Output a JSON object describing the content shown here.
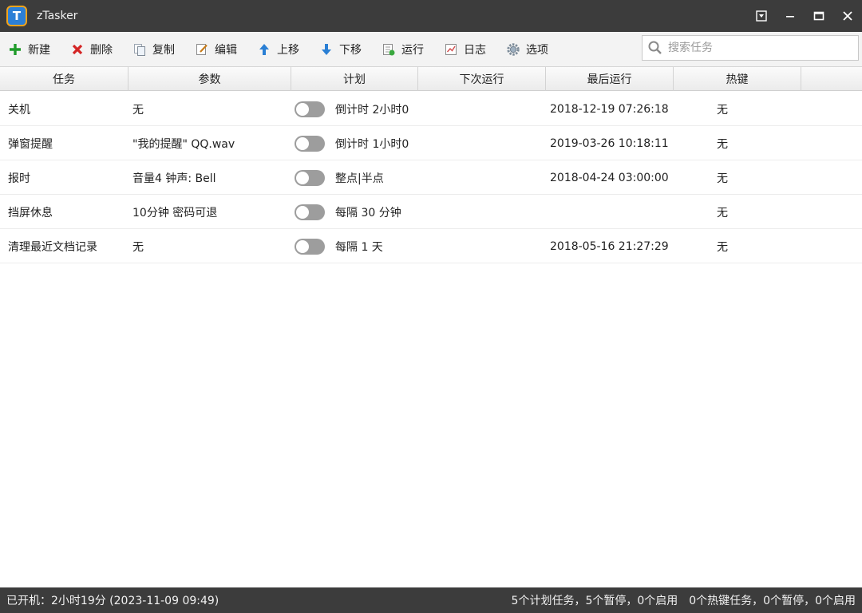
{
  "window": {
    "logo_letter": "T",
    "title": "zTasker",
    "controls": {
      "menu": "▾",
      "minimize": "—",
      "maximize": "☐",
      "close": "✕"
    }
  },
  "toolbar": {
    "buttons": [
      {
        "label": "新建",
        "icon": "plus-icon"
      },
      {
        "label": "删除",
        "icon": "x-icon"
      },
      {
        "label": "复制",
        "icon": "copy-icon"
      },
      {
        "label": "编辑",
        "icon": "edit-icon"
      },
      {
        "label": "上移",
        "icon": "arrow-up-icon"
      },
      {
        "label": "下移",
        "icon": "arrow-down-icon"
      },
      {
        "label": "运行",
        "icon": "run-icon"
      },
      {
        "label": "日志",
        "icon": "log-icon"
      },
      {
        "label": "选项",
        "icon": "gear-icon"
      }
    ],
    "search_placeholder": "搜索任务"
  },
  "table": {
    "headers": [
      "任务",
      "参数",
      "计划",
      "下次运行",
      "最后运行",
      "热键"
    ],
    "rows": [
      {
        "task": "关机",
        "param": "无",
        "enabled": false,
        "plan": "倒计时 2小时0",
        "next": "",
        "last": "2018-12-19 07:26:18",
        "hotkey": "无"
      },
      {
        "task": "弹窗提醒",
        "param": "\"我的提醒\" QQ.wav",
        "enabled": false,
        "plan": "倒计时 1小时0",
        "next": "",
        "last": "2019-03-26 10:18:11",
        "hotkey": "无"
      },
      {
        "task": "报时",
        "param": "音量4 钟声: Bell",
        "enabled": false,
        "plan": "整点|半点",
        "next": "",
        "last": "2018-04-24 03:00:00",
        "hotkey": "无"
      },
      {
        "task": "挡屏休息",
        "param": "10分钟 密码可退",
        "enabled": false,
        "plan": "每隔 30 分钟",
        "next": "",
        "last": "",
        "hotkey": "无"
      },
      {
        "task": "清理最近文档记录",
        "param": "无",
        "enabled": false,
        "plan": "每隔 1 天",
        "next": "",
        "last": "2018-05-16 21:27:29",
        "hotkey": "无"
      }
    ]
  },
  "status": {
    "uptime": "已开机：2小时19分 (2023-11-09 09:49)",
    "scheduled": "5个计划任务，5个暂停，0个启用",
    "hotkeys": "0个热键任务，0个暂停，0个启用"
  },
  "colors": {
    "titlebar": "#3c3c3c",
    "toggle_off": "#9d9d9d",
    "accent_green": "#1f9b2a",
    "accent_red": "#d42424",
    "accent_blue": "#2a7fd4"
  }
}
